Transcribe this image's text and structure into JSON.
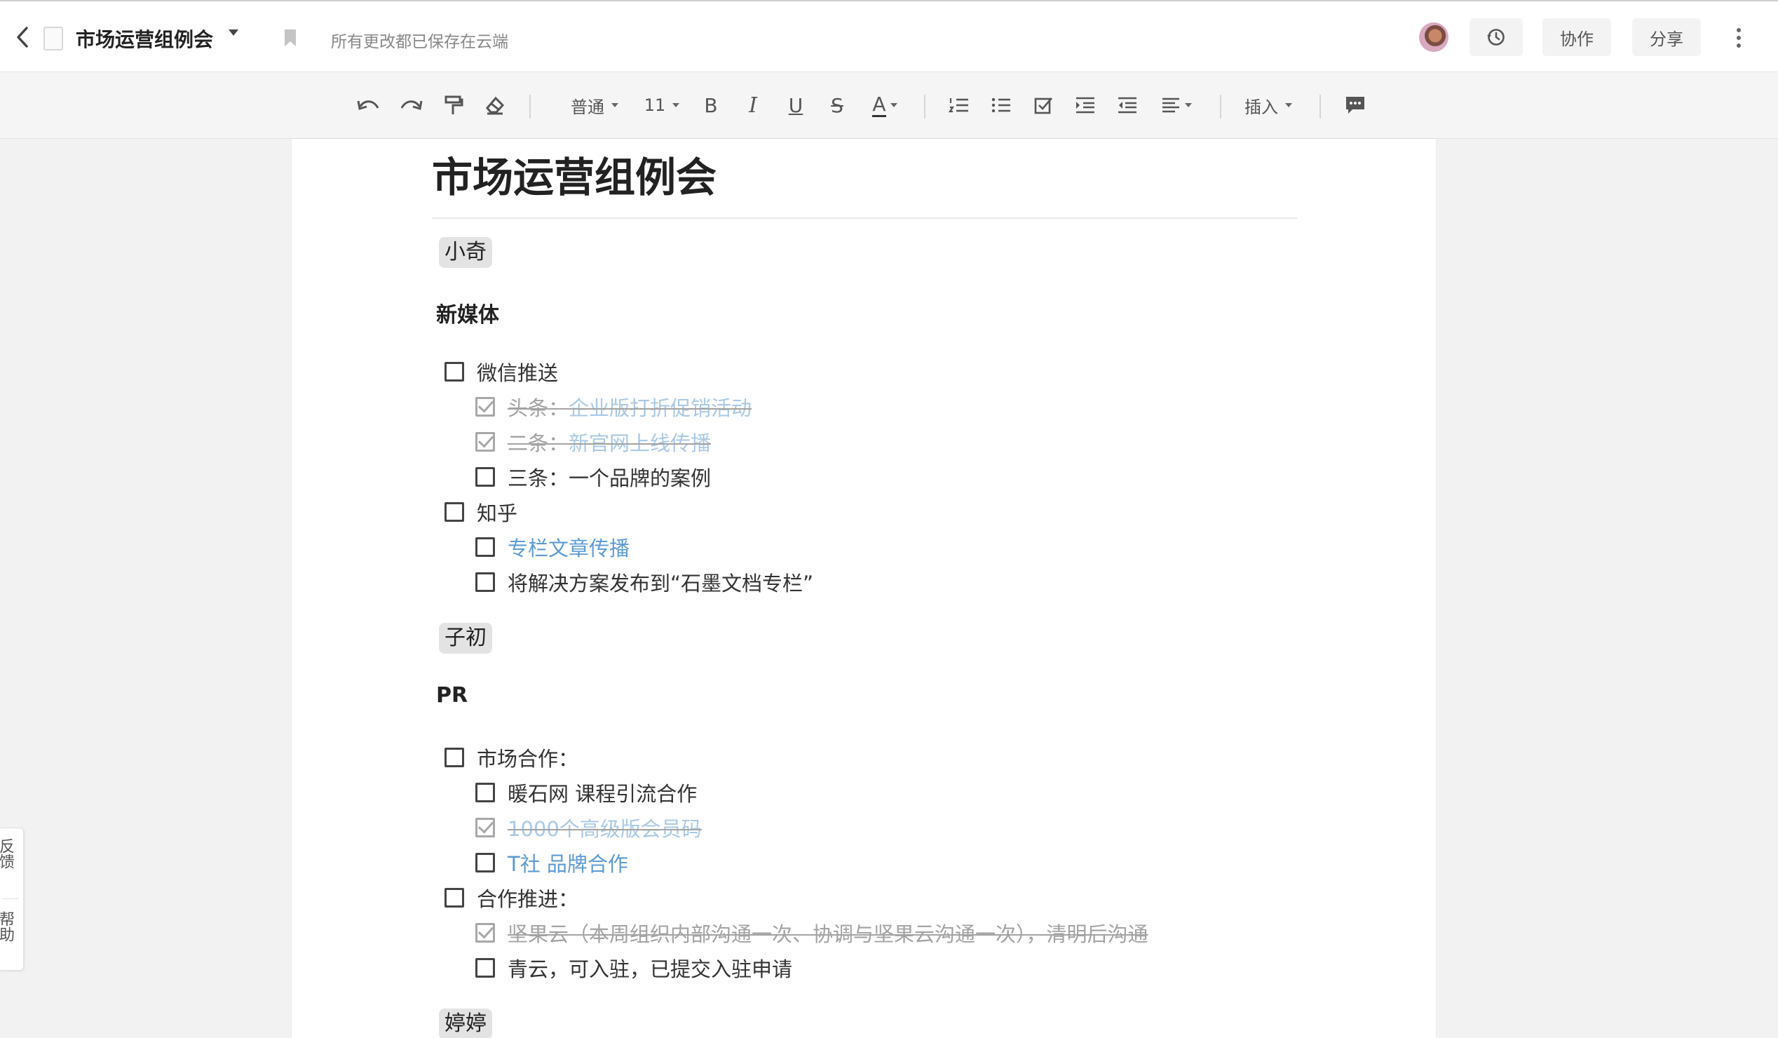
{
  "header": {
    "doc_title": "市场运营组例会",
    "save_status": "所有更改都已保存在云端",
    "collab_label": "协作",
    "share_label": "分享"
  },
  "toolbar": {
    "style": "普通",
    "font_size": "11",
    "bold": "B",
    "italic": "I",
    "underline": "U",
    "strike": "S",
    "text_color": "A",
    "insert": "插入"
  },
  "doc": {
    "title": "市场运营组例会",
    "sections": [
      {
        "mention": "小奇",
        "heading": "新媒体",
        "items": [
          {
            "text": "微信推送",
            "checked": false,
            "level": 1
          },
          {
            "prefix": "头条：",
            "text": "企业版打折促销活动",
            "checked": true,
            "level": 2,
            "link": true
          },
          {
            "prefix": "二条：",
            "text": "新官网上线传播",
            "checked": true,
            "level": 2,
            "link": true
          },
          {
            "text": "三条：一个品牌的案例",
            "checked": false,
            "level": 2
          },
          {
            "text": "知乎",
            "checked": false,
            "level": 1
          },
          {
            "text": "专栏文章传播",
            "checked": false,
            "level": 2,
            "link": true
          },
          {
            "text": "将解决方案发布到“石墨文档专栏”",
            "checked": false,
            "level": 2
          }
        ]
      },
      {
        "mention": "子初",
        "heading": "PR",
        "items": [
          {
            "text": "市场合作：",
            "checked": false,
            "level": 1
          },
          {
            "text": "暖石网 课程引流合作",
            "checked": false,
            "level": 2
          },
          {
            "text": "1000个高级版会员码",
            "checked": true,
            "level": 2,
            "link": true
          },
          {
            "text": "T社 品牌合作",
            "checked": false,
            "level": 2,
            "link": true
          },
          {
            "text": "合作推进：",
            "checked": false,
            "level": 1
          },
          {
            "text": "坚果云（本周组织内部沟通一次、协调与坚果云沟通一次），清明后沟通",
            "checked": true,
            "level": 2
          },
          {
            "text": "青云，可入驻，已提交入驻申请",
            "checked": false,
            "level": 2
          }
        ]
      }
    ],
    "next_mention": "婷婷"
  },
  "sidebar": {
    "feedback": "反馈",
    "help": "帮助"
  },
  "colors": {
    "link": "#5d9bd5",
    "done_text": "#a3a3a3",
    "mention_bg": "#e3e3e3"
  }
}
